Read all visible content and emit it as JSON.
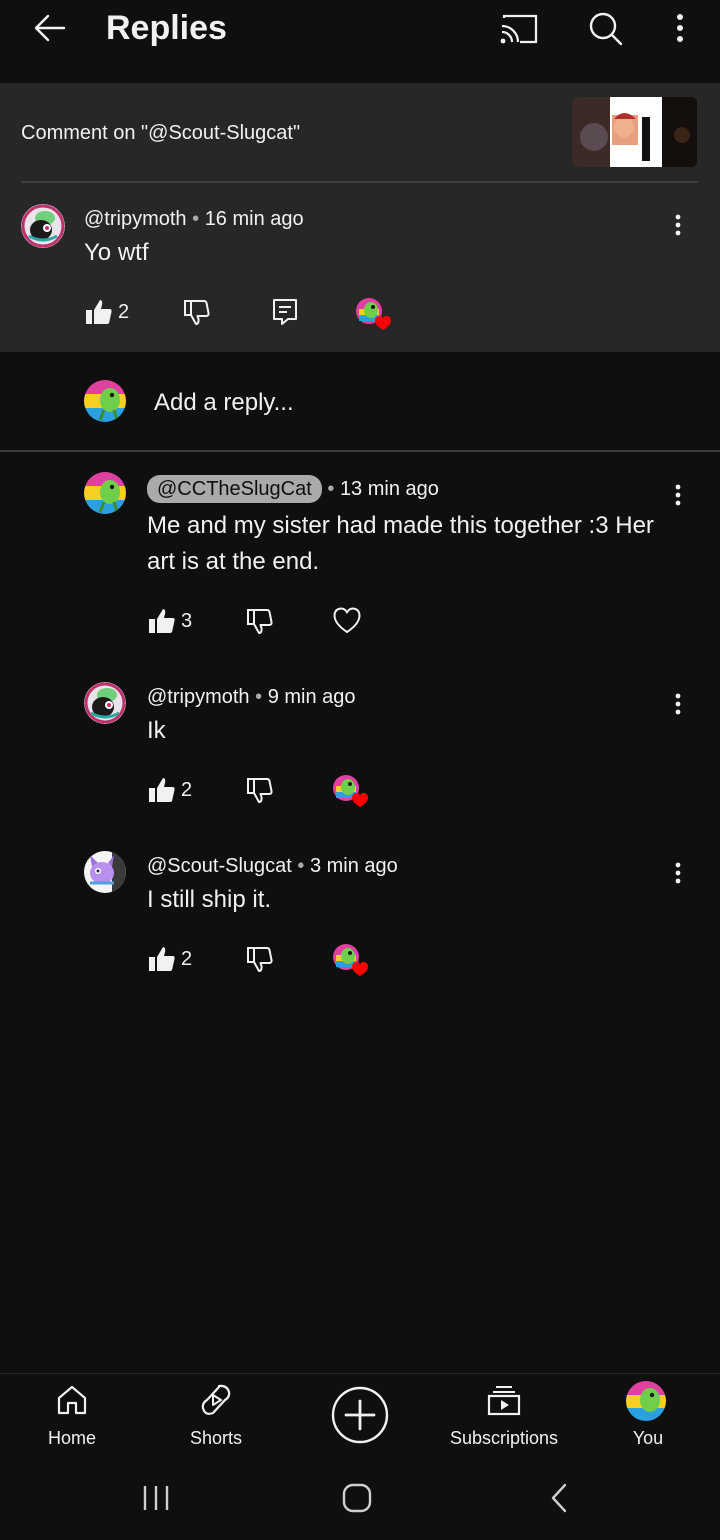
{
  "header": {
    "title": "Replies",
    "back_icon": "arrow-left-icon",
    "cast_icon": "cast-icon",
    "search_icon": "search-icon",
    "more_icon": "more-vertical-icon"
  },
  "context": {
    "label": "Comment on \"@Scout-Slugcat\""
  },
  "parent_comment": {
    "author": "@tripymoth",
    "time": "16 min ago",
    "text": "Yo wtf",
    "likes": "2"
  },
  "add_reply": {
    "placeholder": "Add a reply..."
  },
  "replies": [
    {
      "author": "@CCTheSlugCat",
      "time": "13 min ago",
      "text": "Me and my sister had made this together :3 Her art is at the end.",
      "likes": "3"
    },
    {
      "author": "@tripymoth",
      "time": "9 min ago",
      "text": "Ik",
      "likes": "2"
    },
    {
      "author": "@Scout-Slugcat",
      "time": "3 min ago",
      "text": "I still ship it.",
      "likes": "2"
    }
  ],
  "bottom_nav": {
    "home": "Home",
    "shorts": "Shorts",
    "subscriptions": "Subscriptions",
    "you": "You"
  },
  "colors": {
    "background": "#0f0f0f",
    "panel": "#272727",
    "text": "#f1f1f1",
    "secondary": "#aaaaaa",
    "heart": "#ff0000"
  }
}
